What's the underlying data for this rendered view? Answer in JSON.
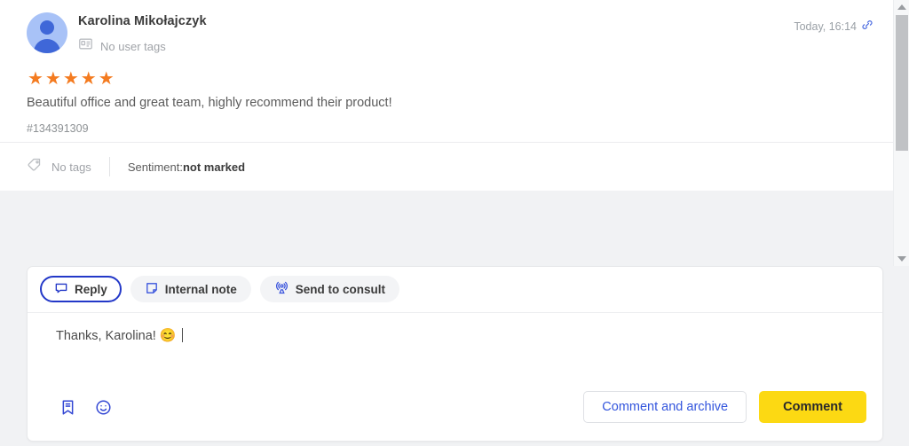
{
  "review": {
    "author": "Karolina Mikołajczyk",
    "user_tags_label": "No user tags",
    "user_tags_icon": "id-badge-icon",
    "timestamp": "Today, 16:14",
    "link_icon": "link-icon",
    "rating": 5,
    "rating_max": 5,
    "stars_glyphs": "★★★★★",
    "star_color": "#f47b20",
    "text": "Beautiful office and great team, highly recommend their product!",
    "id": "#134391309",
    "footer": {
      "tags_icon": "tag-icon",
      "tags_label": "No tags",
      "sentiment_label": "Sentiment:",
      "sentiment_value": "not marked"
    }
  },
  "reply": {
    "tabs": [
      {
        "label": "Reply",
        "icon": "chat-bubble-icon",
        "active": true
      },
      {
        "label": "Internal note",
        "icon": "sticky-note-icon",
        "active": false
      },
      {
        "label": "Send to consult",
        "icon": "broadcast-icon",
        "active": false
      }
    ],
    "draft_text": "Thanks, Karolina!",
    "draft_emoji": "😊",
    "toolbar_icons": [
      {
        "name": "saved-replies-icon"
      },
      {
        "name": "emoji-picker-icon"
      }
    ],
    "secondary_button": "Comment and archive",
    "primary_button": "Comment",
    "accent_color": "#2338c8",
    "primary_button_color": "#fcd913"
  },
  "scrollbar": {
    "up_arrow": "scroll-up-arrow-icon",
    "down_arrow": "scroll-down-arrow-icon"
  }
}
